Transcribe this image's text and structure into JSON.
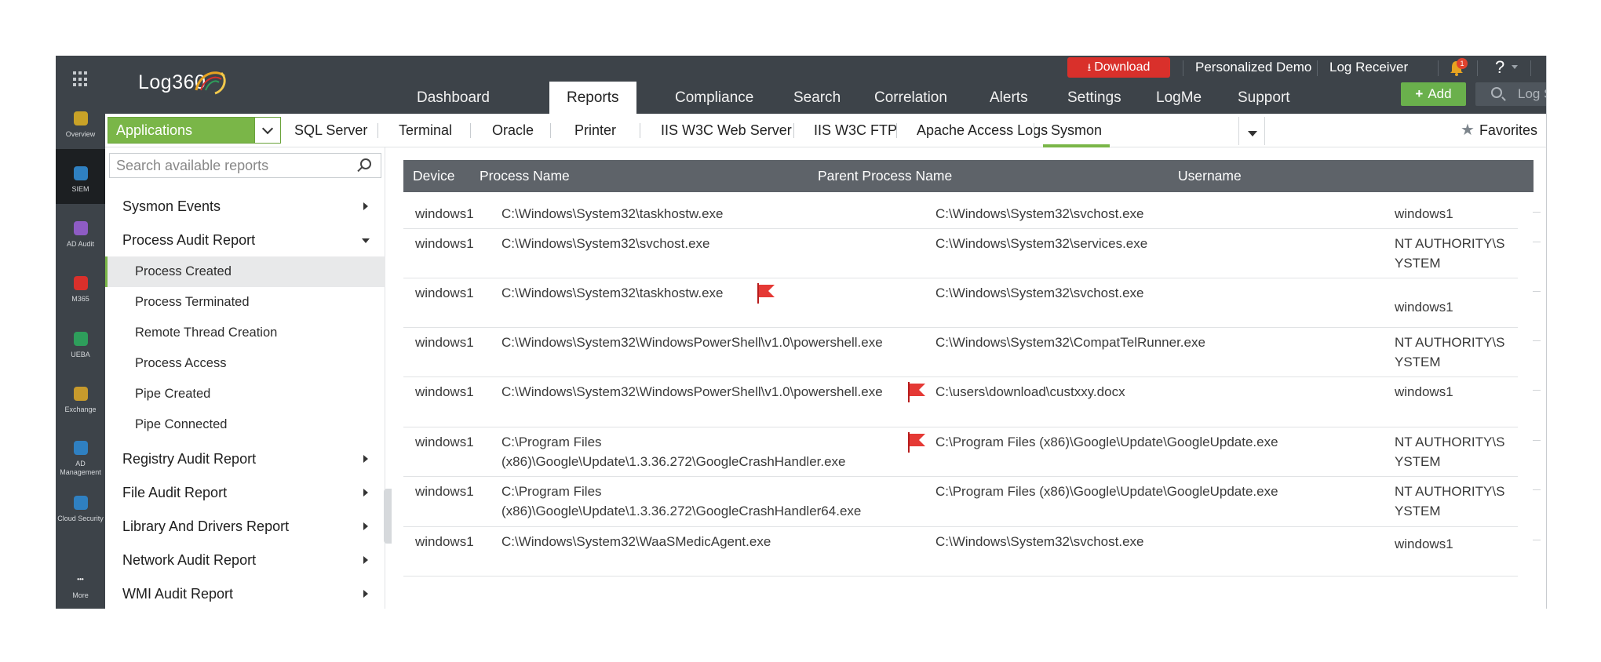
{
  "rail": {
    "items": [
      {
        "label": "Overview",
        "icon": "overview-icon",
        "color": "#c9a227"
      },
      {
        "label": "SIEM",
        "icon": "siem-shield-icon",
        "color": "#2f80c1"
      },
      {
        "label": "AD Audit",
        "icon": "ad-audit-icon",
        "color": "#8e5cc4"
      },
      {
        "label": "M365",
        "icon": "m365-icon",
        "color": "#d9302b"
      },
      {
        "label": "UEBA",
        "icon": "ueba-eye-icon",
        "color": "#2e9e5b"
      },
      {
        "label": "Exchange",
        "icon": "exchange-icon",
        "color": "#c79a2c"
      },
      {
        "label": "AD Management",
        "icon": "ad-management-icon",
        "color": "#2f80c1"
      },
      {
        "label": "Cloud Security",
        "icon": "cloud-security-icon",
        "color": "#2f80c1"
      },
      {
        "label": "More",
        "icon": "more-dots-icon",
        "color": "#ffffff"
      }
    ]
  },
  "header": {
    "logo_text": "Log360",
    "download_label": "Download",
    "personalized_demo": "Personalized Demo",
    "log_receiver": "Log Receiver",
    "notification_count": "1",
    "help_glyph": "?",
    "add_label": "Add",
    "log_search_label": "Log Search",
    "nav_tabs": [
      "Dashboard",
      "Reports",
      "Compliance",
      "Search",
      "Correlation",
      "Alerts",
      "Settings",
      "LogMe",
      "Support"
    ],
    "active_tab": "Reports"
  },
  "subbar": {
    "app_select_value": "Applications",
    "tabs": [
      "SQL Server",
      "Terminal",
      "Oracle",
      "Printer",
      "IIS W3C Web Server",
      "IIS W3C FTP",
      "Apache Access Logs",
      "Sysmon"
    ],
    "active_tab": "Sysmon",
    "favorites_label": "Favorites"
  },
  "sidebar": {
    "search_placeholder": "Search available reports",
    "categories": [
      {
        "label": "Sysmon Events",
        "expanded": false
      },
      {
        "label": "Process Audit Report",
        "expanded": true,
        "children": [
          "Process Created",
          "Process Terminated",
          "Remote Thread Creation",
          "Process Access",
          "Pipe Created",
          "Pipe Connected"
        ],
        "active_child": "Process Created"
      },
      {
        "label": "Registry Audit Report",
        "expanded": false
      },
      {
        "label": "File Audit Report",
        "expanded": false
      },
      {
        "label": "Library And Drivers Report",
        "expanded": false
      },
      {
        "label": "Network Audit Report",
        "expanded": false
      },
      {
        "label": "WMI Audit Report",
        "expanded": false
      }
    ]
  },
  "table": {
    "columns": [
      "Device",
      "Process Name",
      "Parent Process Name",
      "Username"
    ],
    "rows": [
      {
        "device": "windows1",
        "process": "C:\\Windows\\System32\\taskhostw.exe",
        "parent": "C:\\Windows\\System32\\svchost.exe",
        "user": "windows1",
        "flag_after_process": false,
        "flag_before_parent": false
      },
      {
        "device": "windows1",
        "process": "C:\\Windows\\System32\\svchost.exe",
        "parent": "C:\\Windows\\System32\\services.exe",
        "user": "NT AUTHORITY\\SYSTEM",
        "flag_after_process": false,
        "flag_before_parent": false
      },
      {
        "device": "windows1",
        "process": "C:\\Windows\\System32\\taskhostw.exe",
        "parent": "C:\\Windows\\System32\\svchost.exe",
        "user": "windows1",
        "flag_after_process": true,
        "flag_before_parent": false
      },
      {
        "device": "windows1",
        "process": "C:\\Windows\\System32\\WindowsPowerShell\\v1.0\\powershell.exe",
        "parent": "C:\\Windows\\System32\\CompatTelRunner.exe",
        "user": "NT AUTHORITY\\SYSTEM",
        "flag_after_process": false,
        "flag_before_parent": false
      },
      {
        "device": "windows1",
        "process": "C:\\Windows\\System32\\WindowsPowerShell\\v1.0\\powershell.exe",
        "parent": "C:\\users\\download\\custxxy.docx",
        "user": "windows1",
        "flag_after_process": false,
        "flag_before_parent": true
      },
      {
        "device": "windows1",
        "process": "C:\\Program Files (x86)\\Google\\Update\\1.3.36.272\\GoogleCrashHandler.exe",
        "parent": "C:\\Program Files (x86)\\Google\\Update\\GoogleUpdate.exe",
        "user": "NT AUTHORITY\\SYSTEM",
        "flag_after_process": false,
        "flag_before_parent": true
      },
      {
        "device": "windows1",
        "process": "C:\\Program Files (x86)\\Google\\Update\\1.3.36.272\\GoogleCrashHandler64.exe",
        "parent": "C:\\Program Files (x86)\\Google\\Update\\GoogleUpdate.exe",
        "user": "NT AUTHORITY\\SYSTEM",
        "flag_after_process": false,
        "flag_before_parent": false
      },
      {
        "device": "windows1",
        "process": "C:\\Windows\\System32\\WaaSMedicAgent.exe",
        "parent": "C:\\Windows\\System32\\svchost.exe",
        "user": "windows1",
        "flag_after_process": false,
        "flag_before_parent": false
      }
    ]
  },
  "colors": {
    "header_bg": "#3d4349",
    "accent_green": "#7ab648",
    "download_red": "#d9302b",
    "table_header_bg": "#5e6369",
    "flag_red": "#e53935"
  }
}
